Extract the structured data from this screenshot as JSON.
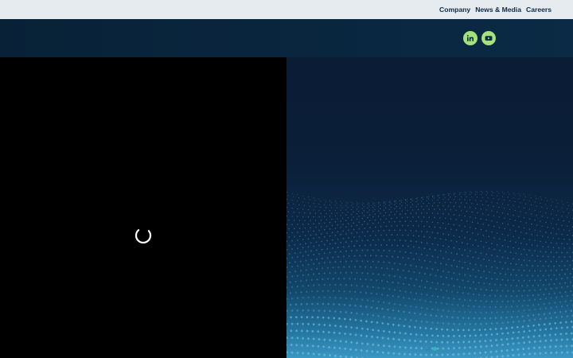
{
  "topnav": {
    "items": [
      {
        "label": "Company"
      },
      {
        "label": "News & Media"
      },
      {
        "label": "Careers"
      }
    ]
  },
  "social": {
    "linkedin_icon": "linkedin-icon",
    "youtube_icon": "youtube-icon",
    "color": "#a4e27a"
  },
  "video": {
    "state_icon": "loading-spinner-icon"
  },
  "hero": {
    "slides_count_icon": "slider-dot-icon"
  }
}
